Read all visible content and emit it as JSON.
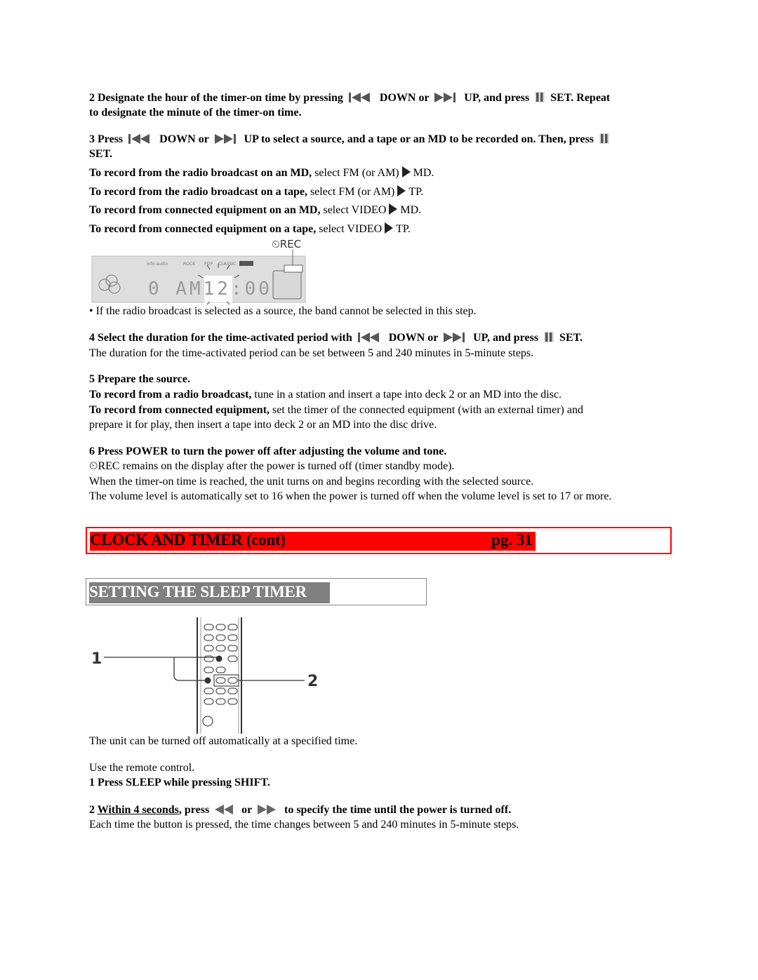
{
  "step2": {
    "prefix": "2 Designate the hour of the timer-on time by pressing",
    "down": "DOWN or",
    "up": "UP, and press",
    "set": "SET.  Repeat",
    "line2": "to designate the minute of the timer-on time.",
    "icons": [
      "skip-back-icon",
      "skip-forward-icon",
      "pause-set-icon"
    ]
  },
  "step3": {
    "prefix": "3 Press",
    "down": "DOWN or",
    "middle": "UP to select a source, and a tape or an MD to be recorded on.  Then, press",
    "line2": "SET."
  },
  "record_options": [
    {
      "bold": "To record from the radio broadcast on an MD,",
      "text": "select FM (or AM)",
      "target": "MD."
    },
    {
      "bold": "To record from the radio broadcast on a tape,",
      "text": "select FM (or AM)",
      "target": "TP."
    },
    {
      "bold": "To record from connected equipment on an MD,",
      "text": "select VIDEO",
      "target": "MD."
    },
    {
      "bold": "To record from connected equipment on a tape,",
      "text": "select VIDEO",
      "target": "TP."
    }
  ],
  "display": {
    "label": "⏲REC",
    "readout": "0 AM12:00",
    "modes": [
      "ROCK",
      "POP",
      "CLASSIC"
    ]
  },
  "note_radio": "• If the radio broadcast is selected as a source, the band cannot be selected in this step.",
  "step4": {
    "prefix": "4 Select the duration for the time-activated period with",
    "down": "DOWN or",
    "up": "UP, and press",
    "set": "SET.",
    "body": "The duration for the time-activated period can be set between 5 and 240 minutes in 5-minute steps."
  },
  "step5": {
    "title": "5 Prepare the source.",
    "radio_bold": "To record from a radio broadcast,",
    "radio_text": "tune in a station and insert a tape into deck 2 or an MD into the disc.",
    "equip_bold": "To record from connected equipment,",
    "equip_text": "set the timer of the connected equipment (with an external timer) and",
    "equip_line2": "prepare it for play, then insert a tape into deck 2 or an MD into the disc drive."
  },
  "step6": {
    "title": "6 Press POWER to turn the power off after adjusting the volume and tone.",
    "line1": "⏲REC remains on the display after the power is turned off (timer standby mode).",
    "line2": "When the timer-on time is reached, the unit turns on and begins recording with the selected source.",
    "line3": "The volume level is automatically set to 16 when the power is turned off when the volume level is set to 17 or more."
  },
  "section": {
    "title": "CLOCK AND TIMER (cont)",
    "page": "pg. 31",
    "accent": "#ff0000"
  },
  "subsection": {
    "title": "SETTING THE SLEEP TIMER",
    "bg": "#808080"
  },
  "remote_figure": {
    "callouts": [
      "1",
      "2"
    ]
  },
  "sleep": {
    "intro": "The unit can be turned off automatically at a specified time.",
    "use": "Use the remote control.",
    "step1": "1 Press SLEEP while pressing SHIFT.",
    "step2_num": "2 ",
    "step2_underlined": "Within 4 seconds",
    "step2_press": ", press",
    "step2_or": "or",
    "step2_rest": "to specify the time until the power is turned off.",
    "step2_body": "Each time the button is pressed, the time changes between 5 and 240 minutes in 5-minute steps."
  }
}
